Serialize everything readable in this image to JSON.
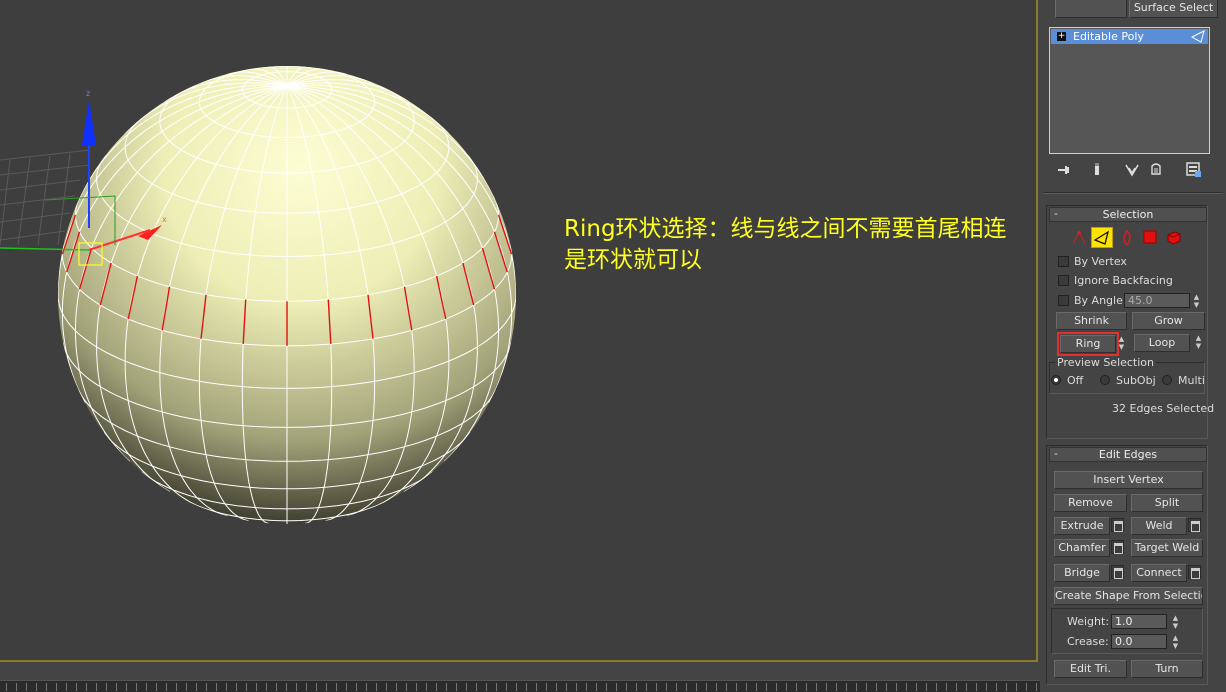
{
  "viewport": {
    "annotation_line1": "Ring环状选择：线与线之间不需要首尾相连",
    "annotation_line2": "是环状就可以",
    "gizmo_axis_z": "z",
    "gizmo_axis_x": "x"
  },
  "top": {
    "surface_select_label": "Surface Select"
  },
  "modifier_stack": {
    "items": [
      {
        "label": "Editable Poly"
      }
    ]
  },
  "stack_toolbar": {
    "icons": [
      "pin-stack-icon",
      "show-end-result-icon",
      "make-unique-icon",
      "remove-modifier-icon",
      "configure-modifier-sets-icon"
    ]
  },
  "selection": {
    "title": "Selection",
    "subobject_icons": [
      "vertex-icon",
      "edge-icon",
      "border-icon",
      "polygon-icon",
      "element-icon"
    ],
    "by_vertex": "By Vertex",
    "ignore_backfacing": "Ignore Backfacing",
    "by_angle": "By Angle:",
    "angle_value": "45.0",
    "shrink": "Shrink",
    "grow": "Grow",
    "ring": "Ring",
    "loop": "Loop",
    "preview_title": "Preview Selection",
    "preview_off": "Off",
    "preview_subobj": "SubObj",
    "preview_multi": "Multi",
    "status": "32 Edges Selected"
  },
  "edit_edges": {
    "title": "Edit Edges",
    "insert_vertex": "Insert Vertex",
    "remove": "Remove",
    "split": "Split",
    "extrude": "Extrude",
    "weld": "Weld",
    "chamfer": "Chamfer",
    "target_weld": "Target Weld",
    "bridge": "Bridge",
    "connect": "Connect",
    "create_shape": "Create Shape From Selection",
    "weight_label": "Weight:",
    "weight_value": "1.0",
    "crease_label": "Crease:",
    "crease_value": "0.0",
    "edit_tri": "Edit Tri.",
    "turn": "Turn"
  },
  "colors": {
    "annotation": "#ffff20",
    "selected_edges": "#e01010",
    "highlight_box": "#e03030",
    "active_subobject": "#ffe400"
  }
}
